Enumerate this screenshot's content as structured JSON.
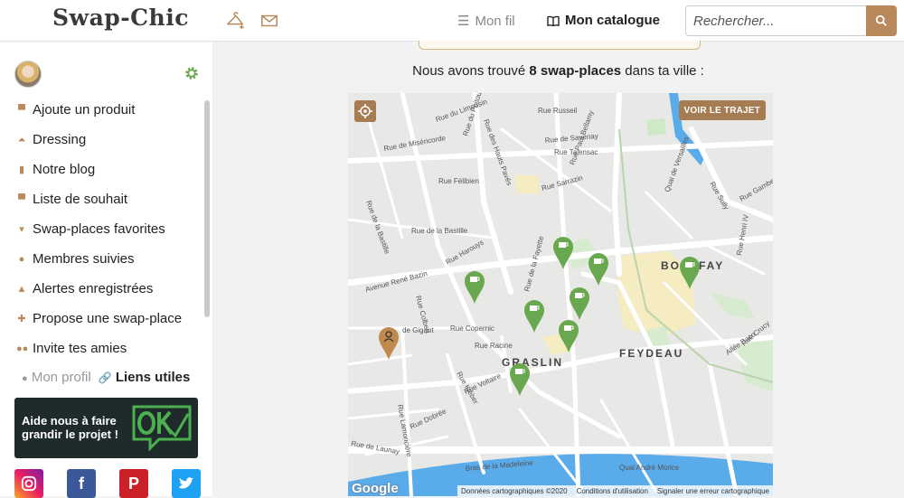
{
  "header": {
    "logo": "Swap-Chic",
    "nav": {
      "feed": "Mon fil",
      "catalog": "Mon catalogue"
    },
    "search": {
      "placeholder": "Rechercher..."
    },
    "icons": {
      "hanger": "hanger-plus-icon",
      "mail": "mail-icon",
      "search": "search-icon"
    }
  },
  "sidebar": {
    "menu": [
      {
        "label": "Ajoute un produit",
        "icon": "tshirt-icon"
      },
      {
        "label": "Dressing",
        "icon": "hanger-icon"
      },
      {
        "label": "Notre blog",
        "icon": "document-icon"
      },
      {
        "label": "Liste de souhait",
        "icon": "tshirt-icon"
      },
      {
        "label": "Swap-places favorites",
        "icon": "coffee-icon"
      },
      {
        "label": "Membres suivies",
        "icon": "user-check-icon"
      },
      {
        "label": "Alertes enregistrées",
        "icon": "bell-icon"
      },
      {
        "label": "Propose une swap-place",
        "icon": "coffee-plus-icon"
      },
      {
        "label": "Invite tes amies",
        "icon": "users-icon"
      }
    ],
    "profile_tabs": {
      "profile": "Mon profil",
      "links": "Liens utiles"
    },
    "banner": {
      "text": "Aide nous à faire grandir le projet !"
    },
    "socials": [
      "instagram",
      "facebook",
      "pinterest",
      "twitter"
    ]
  },
  "main": {
    "found_prefix": "Nous avons trouvé ",
    "found_count": "8 swap-places",
    "found_suffix": " dans ta ville :",
    "map": {
      "route_button": "VOIR LE TRAJET",
      "districts": [
        "BOUFFAY",
        "FEYDEAU",
        "GRASLIN"
      ],
      "streets": [
        "Rue du Limousin",
        "Rue des Hauts Pavés",
        "Rue du Poitou",
        "Rue Russeil",
        "Rue Paul Bellamy",
        "Rue de Miséricorde",
        "Rue de Savenay",
        "Rue Talensac",
        "Rue Félibien",
        "Rue Sarrazin",
        "Rue de la Bastille",
        "Rue Harouys",
        "Rue Copernic",
        "Rue Racine",
        "Rue Kléber",
        "Rue Voltaire",
        "Rue de Gigant",
        "Rue Lamoricière",
        "Rue Dobrée",
        "Rue de Launay",
        "Bras de la Madeleine",
        "Quai André Morice",
        "Allée Baco",
        "Rue Gambetta",
        "Rue Sully",
        "Rue Henri IV",
        "Avenue René Bazin",
        "Rue Colbert",
        "Rue de la Fayette",
        "Rue Crucy",
        "Quai de Versailles"
      ],
      "markers_count": 8,
      "google": "Google",
      "attribution": [
        "Données cartographiques ©2020",
        "Conditions d'utilisation",
        "Signaler une erreur cartographique"
      ]
    }
  },
  "colors": {
    "accent": "#b8895a",
    "marker_green": "#6aa84f",
    "marker_user": "#c08a4d",
    "water": "#4ea7e8"
  }
}
